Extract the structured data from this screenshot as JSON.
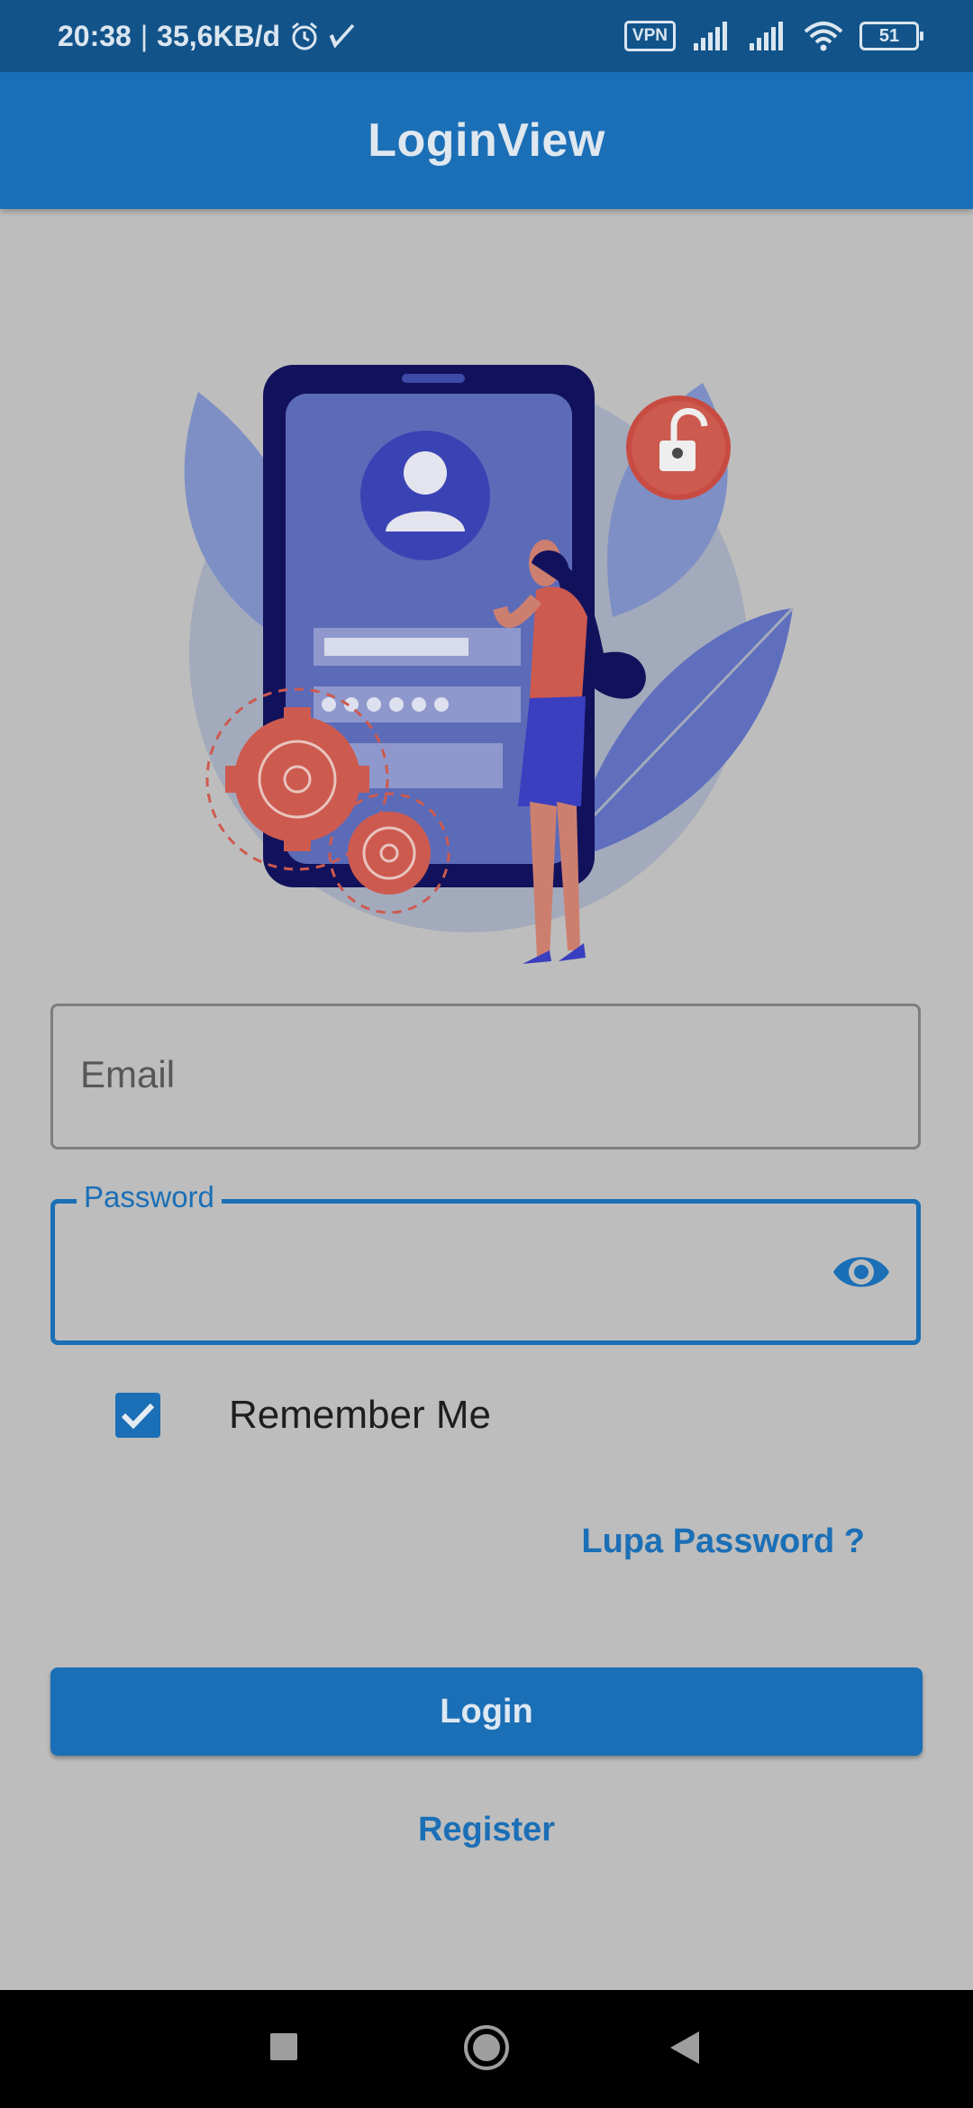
{
  "status_bar": {
    "time": "20:38",
    "separator": "|",
    "data_rate": "35,6KB/d",
    "vpn": "VPN",
    "battery": "51"
  },
  "app_bar": {
    "title": "LoginView"
  },
  "form": {
    "email_placeholder": "Email",
    "password_label": "Password",
    "password_value": "",
    "remember_me_label": "Remember Me",
    "remember_me_checked": true,
    "forgot_password": "Lupa Password ?",
    "login_button": "Login",
    "register_link": "Register"
  },
  "colors": {
    "primary": "#1b6fb6",
    "status_bar": "#12548a",
    "background": "#bdbdbd"
  },
  "icons": [
    "alarm-icon",
    "check-icon",
    "signal-icon",
    "wifi-icon",
    "battery-icon",
    "eye-icon",
    "checkbox-check-icon",
    "nav-recents-icon",
    "nav-home-icon",
    "nav-back-icon"
  ]
}
